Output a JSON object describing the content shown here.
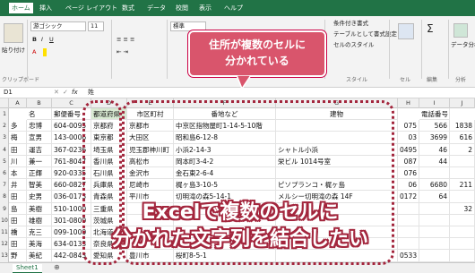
{
  "ribbon_tabs": [
    "ホーム",
    "挿入",
    "ページ レイアウト",
    "数式",
    "データ",
    "校閲",
    "表示",
    "ヘルプ"
  ],
  "ribbon": {
    "paste": "貼り付け",
    "font_name": "游ゴシック",
    "font_size": "11",
    "clipboard": "クリップボード",
    "cond_format": "条件付き書式",
    "table_format": "テーブルとして書式設定",
    "cell_styles": "セルのスタイル",
    "styles": "スタイル",
    "cells": "セル",
    "edit": "編集",
    "analyze": "データ分析",
    "analyze_group": "分析",
    "number_format": "標準"
  },
  "formula_bar": {
    "name_box": "D1",
    "fx": "fx",
    "value": "姓"
  },
  "columns": [
    "A",
    "B",
    "C",
    "D",
    "E",
    "F",
    "G",
    "H",
    "I",
    "J"
  ],
  "header_row": {
    "b": "名",
    "c": "郵便番号",
    "d": "都道府県",
    "e": "市区町村",
    "f": "番地など",
    "g": "建物",
    "i": "電話番号"
  },
  "rows": [
    {
      "a": "多",
      "b": "忠博",
      "c": "604-0095",
      "d": "京都府",
      "e": "京都市",
      "f": "中京区指物屋町1-14-5-10階",
      "g": "",
      "h": "075",
      "i": "566",
      "j": "1838"
    },
    {
      "a": "梅",
      "b": "宣男",
      "c": "143-0006",
      "d": "東京都",
      "e": "大田区",
      "f": "昭和島6-12-8",
      "g": "",
      "h": "03",
      "i": "3699",
      "j": "616"
    },
    {
      "a": "田",
      "b": "運吉",
      "c": "367-0236",
      "d": "埼玉県",
      "e": "児玉郡神川町",
      "f": "小浜2-14-3",
      "g": "シャトル小浜",
      "h": "0495",
      "i": "46",
      "j": "2"
    },
    {
      "a": "川",
      "b": "兼一",
      "c": "761-8047",
      "d": "香川県",
      "e": "高松市",
      "f": "岡本町3-4-2",
      "g": "栄ビル 1014号室",
      "h": "087",
      "i": "44",
      "j": ""
    },
    {
      "a": "本",
      "b": "正輝",
      "c": "920-0335",
      "d": "石川県",
      "e": "金沢市",
      "f": "金石東2-6-4",
      "g": "",
      "h": "076",
      "i": "",
      "j": ""
    },
    {
      "a": "井",
      "b": "智美",
      "c": "660-0827",
      "d": "兵庫県",
      "e": "尼崎市",
      "f": "梶ヶ島3-10-5",
      "g": "ピソプランコ・梶ヶ島",
      "h": "06",
      "i": "6680",
      "j": "211"
    },
    {
      "a": "田",
      "b": "史男",
      "c": "036-0173",
      "d": "青森県",
      "e": "平川市",
      "f": "切明滝の森5-14-1",
      "g": "メルシー切明滝の森 14F",
      "h": "0172",
      "i": "64",
      "j": ""
    },
    {
      "a": "島",
      "b": "美樹",
      "c": "510-1000",
      "d": "三重県",
      "e": "",
      "f": "",
      "g": "",
      "h": "",
      "i": "",
      "j": "32"
    },
    {
      "a": "田",
      "b": "雄樹",
      "c": "301-0800",
      "d": "茨城県",
      "e": "",
      "f": "",
      "g": "",
      "h": "",
      "i": "",
      "j": ""
    },
    {
      "a": "橋",
      "b": "克三",
      "c": "099-1000",
      "d": "北海道",
      "e": "",
      "f": "",
      "g": "",
      "h": "",
      "i": "",
      "j": ""
    },
    {
      "a": "田",
      "b": "美海",
      "c": "634-0133",
      "d": "奈良県",
      "e": "",
      "f": "",
      "g": "",
      "h": "",
      "i": "",
      "j": ""
    },
    {
      "a": "野",
      "b": "美紀",
      "c": "442-0843",
      "d": "愛知県",
      "e": "豊川市",
      "f": "桜町8-5-1",
      "g": "",
      "h": "0533",
      "i": "",
      "j": ""
    }
  ],
  "row_numbers": [
    "1",
    "2",
    "3",
    "4",
    "5",
    "6",
    "7",
    "8",
    "9",
    "10",
    "11",
    "12",
    "13"
  ],
  "sheet_tab": "Sheet1",
  "callout": {
    "line1": "住所が複数のセルに",
    "line2": "分かれている",
    "color": "#d9556c"
  },
  "headline": {
    "line1": "Excelで複数のセルに",
    "line2": "分かれた文字列を結合したい",
    "outline": "#a3263d"
  }
}
